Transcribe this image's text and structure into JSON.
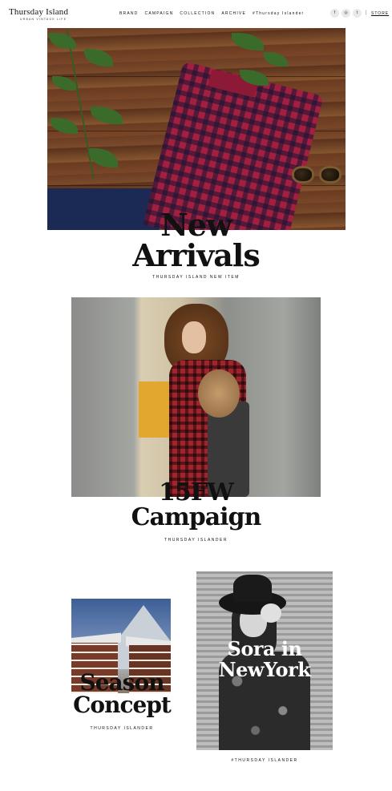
{
  "header": {
    "logo_main": "Thursday Island",
    "logo_sub": "URBAN VINTAGE LIFE",
    "nav": [
      "BRAND",
      "CAMPAIGN",
      "COLLECTION",
      "ARCHIVE",
      "#Thursday Islander"
    ],
    "social_icons": [
      "facebook-icon",
      "instagram-icon",
      "tumblr-icon"
    ],
    "social_glyphs": [
      "f",
      "◎",
      "t"
    ],
    "divider": "|",
    "store": "STORE"
  },
  "new_arrivals": {
    "title_line1": "New",
    "title_line2": "Arrivals",
    "subtitle": "THURSDAY ISLAND NEW ITEM"
  },
  "campaign": {
    "title_line1": "15FW",
    "title_line2": "Campaign",
    "subtitle": "THURSDAY ISLANDER"
  },
  "season": {
    "title_line1": "Season",
    "title_line2": "Concept",
    "subtitle": "THURSDAY ISLANDER"
  },
  "sora": {
    "title_line1": "Sora in",
    "title_line2": "NewYork",
    "subtitle": "#THURSDAY ISLANDER"
  },
  "colors": {
    "text": "#111111",
    "background": "#ffffff",
    "shirt_red": "#a21f3f",
    "wood": "#7b4a2b"
  }
}
